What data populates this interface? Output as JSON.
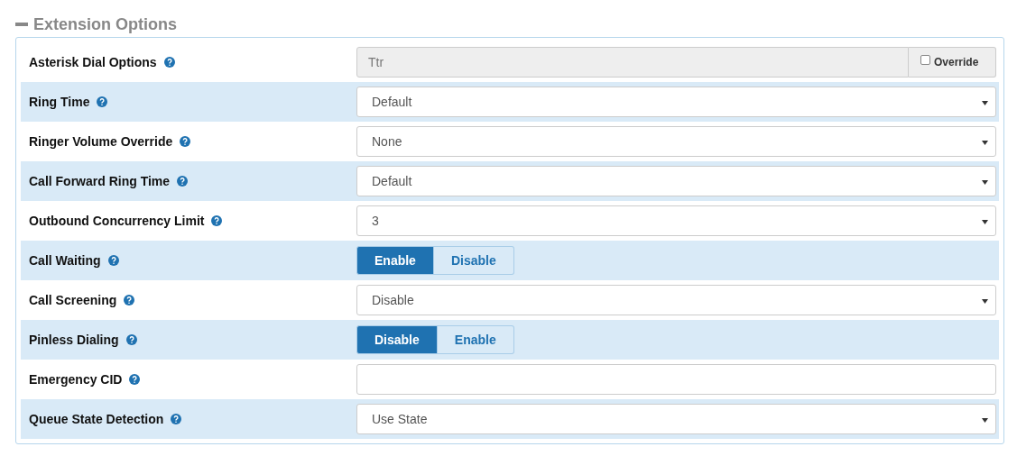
{
  "section": {
    "title": "Extension Options",
    "expanded": true
  },
  "rows": [
    {
      "label": "Asterisk Dial Options",
      "kind": "override",
      "value": "Ttr",
      "disabled": true,
      "override": {
        "label": "Override",
        "checked": false
      }
    },
    {
      "label": "Ring Time",
      "kind": "select",
      "value": "Default"
    },
    {
      "label": "Ringer Volume Override",
      "kind": "select",
      "value": "None"
    },
    {
      "label": "Call Forward Ring Time",
      "kind": "select",
      "value": "Default"
    },
    {
      "label": "Outbound Concurrency Limit",
      "kind": "select",
      "value": "3"
    },
    {
      "label": "Call Waiting",
      "kind": "toggle",
      "options": [
        {
          "label": "Enable",
          "selected": true
        },
        {
          "label": "Disable",
          "selected": false
        }
      ]
    },
    {
      "label": "Call Screening",
      "kind": "select",
      "value": "Disable"
    },
    {
      "label": "Pinless Dialing",
      "kind": "toggle",
      "options": [
        {
          "label": "Disable",
          "selected": true
        },
        {
          "label": "Enable",
          "selected": false
        }
      ]
    },
    {
      "label": "Emergency CID",
      "kind": "text"
    },
    {
      "label": "Queue State Detection",
      "kind": "select",
      "value": "Use State"
    }
  ]
}
